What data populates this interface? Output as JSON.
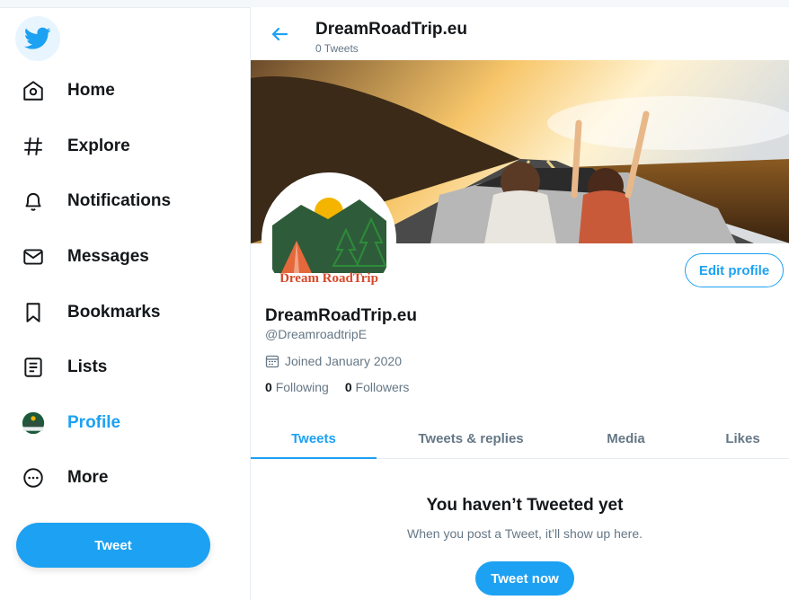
{
  "nav": {
    "items": [
      {
        "label": "Home",
        "icon": "home-icon"
      },
      {
        "label": "Explore",
        "icon": "hashtag-icon"
      },
      {
        "label": "Notifications",
        "icon": "bell-icon"
      },
      {
        "label": "Messages",
        "icon": "envelope-icon"
      },
      {
        "label": "Bookmarks",
        "icon": "bookmark-icon"
      },
      {
        "label": "Lists",
        "icon": "list-icon"
      },
      {
        "label": "Profile",
        "icon": "avatar-icon"
      },
      {
        "label": "More",
        "icon": "more-icon"
      }
    ],
    "tweet_button": "Tweet"
  },
  "header": {
    "title": "DreamRoadTrip.eu",
    "subtitle": "0 Tweets"
  },
  "profile": {
    "name": "DreamRoadTrip.eu",
    "handle": "@DreamroadtripE",
    "joined": "Joined January 2020",
    "following_count": "0",
    "following_label": "Following",
    "followers_count": "0",
    "followers_label": "Followers",
    "edit_button": "Edit profile",
    "avatar_logo_text": "Dream RoadTrip"
  },
  "tabs": [
    "Tweets",
    "Tweets & replies",
    "Media",
    "Likes"
  ],
  "active_tab": "Tweets",
  "empty_state": {
    "title": "You haven’t Tweeted yet",
    "subtitle": "When you post a Tweet, it’ll show up here.",
    "button": "Tweet now"
  },
  "colors": {
    "accent": "#1da1f2",
    "text": "#14171a",
    "muted": "#657786"
  }
}
